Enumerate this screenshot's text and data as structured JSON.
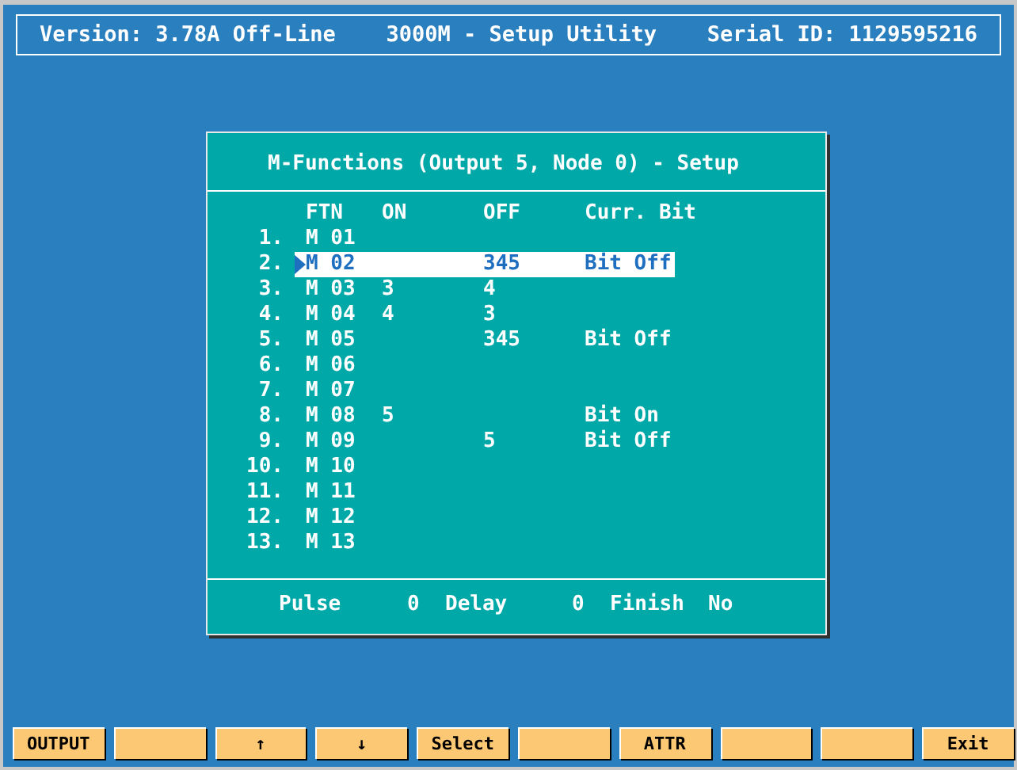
{
  "header": {
    "version": "Version: 3.78A Off-Line",
    "title": "3000M - Setup Utility",
    "serial": "Serial ID: 1129595216"
  },
  "dialog": {
    "title": "M-Functions (Output 5, Node 0) - Setup",
    "columns": [
      "FTN",
      "ON",
      "OFF",
      "Curr. Bit"
    ],
    "rows": [
      {
        "num": "1.",
        "ftn": "M 01",
        "selected": false
      },
      {
        "num": "2.",
        "ftn": "M 02",
        "off": "345",
        "bit": "Bit Off",
        "selected": true
      },
      {
        "num": "3.",
        "ftn": "M 03",
        "on": "3",
        "off": "4",
        "selected": false
      },
      {
        "num": "4.",
        "ftn": "M 04",
        "on": "4",
        "off": "3",
        "selected": false
      },
      {
        "num": "5.",
        "ftn": "M 05",
        "off": "345",
        "bit": "Bit Off",
        "selected": false
      },
      {
        "num": "6.",
        "ftn": "M 06",
        "selected": false
      },
      {
        "num": "7.",
        "ftn": "M 07",
        "selected": false
      },
      {
        "num": "8.",
        "ftn": "M 08",
        "on": "5",
        "bit": "Bit On",
        "selected": false
      },
      {
        "num": "9.",
        "ftn": "M 09",
        "off": "5",
        "bit": "Bit Off",
        "selected": false
      },
      {
        "num": "10.",
        "ftn": "M 10",
        "selected": false
      },
      {
        "num": "11.",
        "ftn": "M 11",
        "selected": false
      },
      {
        "num": "12.",
        "ftn": "M 12",
        "selected": false
      },
      {
        "num": "13.",
        "ftn": "M 13",
        "selected": false
      }
    ],
    "footer": [
      {
        "label": "Pulse",
        "value": "0"
      },
      {
        "label": "Delay",
        "value": "0"
      },
      {
        "label": "Finish",
        "value": "No"
      }
    ]
  },
  "buttons": [
    {
      "kind": "label",
      "label": "OUTPUT"
    },
    {
      "kind": "blank"
    },
    {
      "kind": "label",
      "label": "↑"
    },
    {
      "kind": "label",
      "label": "↓"
    },
    {
      "kind": "label",
      "label": "Select"
    },
    {
      "kind": "blank"
    },
    {
      "kind": "label",
      "label": "ATTR"
    },
    {
      "kind": "blank"
    },
    {
      "kind": "blank"
    },
    {
      "kind": "label",
      "label": "Exit"
    }
  ]
}
